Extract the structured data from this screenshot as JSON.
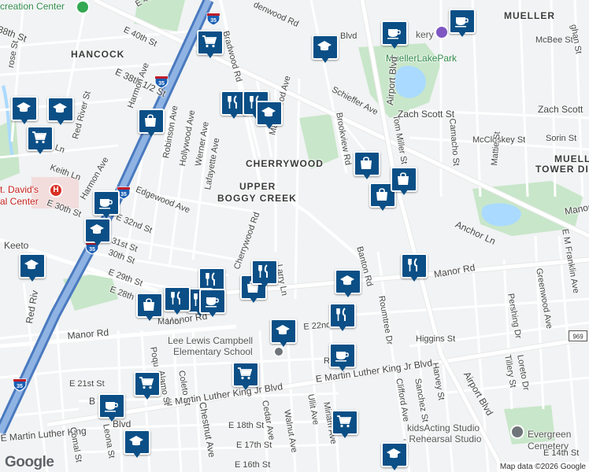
{
  "map": {
    "attribution": "Map data ©2026 Google",
    "logo": "Google",
    "colors": {
      "water": "#aadaff",
      "park": "#c5e8c5",
      "highway": "#5b8cc9",
      "road": "#ffffff",
      "marker": "#0b4f86",
      "hospital": "#d93025"
    },
    "areas": [
      {
        "id": "hancock",
        "text": "HANCOCK"
      },
      {
        "id": "cherrywood",
        "text": "CHERRYWOOD"
      },
      {
        "id": "upper1",
        "text": "UPPER"
      },
      {
        "id": "upper2",
        "text": "BOGGY CREEK"
      },
      {
        "id": "mueller",
        "text": "MUELLER"
      },
      {
        "id": "mtd1",
        "text": "MUELLER"
      },
      {
        "id": "mtd2",
        "text": "TOWER DISTR"
      }
    ],
    "places": [
      {
        "id": "creation",
        "text": "creation Center"
      },
      {
        "id": "stdavid1",
        "text": "t. David's"
      },
      {
        "id": "stdavid2",
        "text": "al Center"
      },
      {
        "id": "school1",
        "text": "Lee Lewis Campbell"
      },
      {
        "id": "school2",
        "text": "Elementary School"
      },
      {
        "id": "muellerpark",
        "text": "MuellerLakePark"
      },
      {
        "id": "kids1",
        "text": "kidsActing Studio"
      },
      {
        "id": "kids2",
        "text": "- Rehearsal Studio"
      },
      {
        "id": "evergreen1",
        "text": "Evergreen"
      },
      {
        "id": "evergreen2",
        "text": "Cemetery"
      },
      {
        "id": "ery",
        "text": "kery"
      }
    ],
    "streets": [
      {
        "id": "s1",
        "text": "E 41st St"
      },
      {
        "id": "s2",
        "text": "E 40th St"
      },
      {
        "id": "s3",
        "text": "E 38th 1/2 St"
      },
      {
        "id": "s4",
        "text": "38th St"
      },
      {
        "id": "s5",
        "text": "rose St"
      },
      {
        "id": "s6",
        "text": "Red River St"
      },
      {
        "id": "s7",
        "text": "Luther Ln"
      },
      {
        "id": "s8",
        "text": "Keith Ln"
      },
      {
        "id": "s9",
        "text": "Harmon Ave"
      },
      {
        "id": "s10",
        "text": "Harmon Ave"
      },
      {
        "id": "s11",
        "text": "Robinson Ave"
      },
      {
        "id": "s12",
        "text": "Hollywood Ave"
      },
      {
        "id": "s13",
        "text": "Werner Ave"
      },
      {
        "id": "s14",
        "text": "Lafayette Ave"
      },
      {
        "id": "s15",
        "text": "Edgewood Ave"
      },
      {
        "id": "s16",
        "text": "E 32nd St"
      },
      {
        "id": "s17",
        "text": "E 30th St"
      },
      {
        "id": "s18",
        "text": "31st St"
      },
      {
        "id": "s19",
        "text": "30th St"
      },
      {
        "id": "s20",
        "text": "E 29th St"
      },
      {
        "id": "s21",
        "text": "E 28th St"
      },
      {
        "id": "s22",
        "text": "Keeto"
      },
      {
        "id": "s23",
        "text": "Red Riv"
      },
      {
        "id": "s24",
        "text": "Bradwood Rd"
      },
      {
        "id": "s25",
        "text": "denwood Rd"
      },
      {
        "id": "s26",
        "text": "Maplewood Ave"
      },
      {
        "id": "s27",
        "text": "Cherrywood Rd"
      },
      {
        "id": "s28",
        "text": "Larry Ln"
      },
      {
        "id": "s29",
        "text": "Schieffer Ave"
      },
      {
        "id": "s30",
        "text": "Brookview Rd"
      },
      {
        "id": "s31",
        "text": "Airport Blvd"
      },
      {
        "id": "s32",
        "text": "Tom Miller St"
      },
      {
        "id": "s33",
        "text": "Zach Scott St"
      },
      {
        "id": "s34",
        "text": "Zach Scott"
      },
      {
        "id": "s35",
        "text": "McBee St"
      },
      {
        "id": "s36",
        "text": "McCloskey St"
      },
      {
        "id": "s37",
        "text": "Sorin St"
      },
      {
        "id": "s38",
        "text": "Camacho St"
      },
      {
        "id": "s39",
        "text": "Mattie St"
      },
      {
        "id": "s40",
        "text": "Anchor Ln"
      },
      {
        "id": "s41",
        "text": "Manor Rd"
      },
      {
        "id": "s42",
        "text": "Banton Rd"
      },
      {
        "id": "s43",
        "text": "Manor Rd"
      },
      {
        "id": "s44",
        "text": "Manor Rd"
      },
      {
        "id": "s45",
        "text": "Manor"
      },
      {
        "id": "s46",
        "text": "Roumtree Dr"
      },
      {
        "id": "s47",
        "text": "Higgins St"
      },
      {
        "id": "s48",
        "text": "E M Franklin Ave"
      },
      {
        "id": "s49",
        "text": "Greenwood Ave"
      },
      {
        "id": "s50",
        "text": "Pershing Dr"
      },
      {
        "id": "s51",
        "text": "Loreto Dr"
      },
      {
        "id": "s52",
        "text": "Tillery St"
      },
      {
        "id": "s53",
        "text": "Airport Blvd"
      },
      {
        "id": "s54",
        "text": "Harvey St"
      },
      {
        "id": "s55",
        "text": "Sanchez St"
      },
      {
        "id": "s56",
        "text": "Clifford Ave"
      },
      {
        "id": "s57",
        "text": "E Martin Luther King Jr Blvd"
      },
      {
        "id": "s58",
        "text": "E Martin Luther King Jr Blvd"
      },
      {
        "id": "s59",
        "text": "E Martin Luther King"
      },
      {
        "id": "s60",
        "text": "E 22nd St"
      },
      {
        "id": "s61",
        "text": "E 21st St"
      },
      {
        "id": "s62",
        "text": "E 18th St"
      },
      {
        "id": "s63",
        "text": "E 17th St"
      },
      {
        "id": "s64",
        "text": "E 16th St"
      },
      {
        "id": "s65",
        "text": "E 14th St"
      },
      {
        "id": "s66",
        "text": "Alamo St"
      },
      {
        "id": "s67",
        "text": "Coleto St"
      },
      {
        "id": "s68",
        "text": "Chestnut Ave"
      },
      {
        "id": "s69",
        "text": "Cedar Ave"
      },
      {
        "id": "s70",
        "text": "Walnut Ave"
      },
      {
        "id": "s71",
        "text": "Ullit Ave"
      },
      {
        "id": "s72",
        "text": "Miriam Ave"
      },
      {
        "id": "s73",
        "text": "Leona St"
      },
      {
        "id": "s74",
        "text": "Comal St"
      },
      {
        "id": "s75",
        "text": "Poqu"
      },
      {
        "id": "s76",
        "text": "Ro"
      },
      {
        "id": "s77",
        "text": "B"
      },
      {
        "id": "s78",
        "text": "Blvd"
      },
      {
        "id": "s79",
        "text": "Manor"
      },
      {
        "id": "s80",
        "text": "ghan St"
      },
      {
        "id": "s81",
        "text": "Blvd"
      }
    ],
    "shields": [
      {
        "id": "i35a",
        "text": "35"
      },
      {
        "id": "i35b",
        "text": "35"
      },
      {
        "id": "i35c",
        "text": "35"
      },
      {
        "id": "i35d",
        "text": "35"
      },
      {
        "id": "i35e",
        "text": "35"
      },
      {
        "id": "r969",
        "text": "969"
      }
    ],
    "markers": [
      {
        "id": "m1",
        "icon": "school-icon"
      },
      {
        "id": "m2",
        "icon": "school-icon"
      },
      {
        "id": "m3",
        "icon": "grocery-cart-icon"
      },
      {
        "id": "m4",
        "icon": "shopping-bag-icon"
      },
      {
        "id": "m5",
        "icon": "grocery-cart-icon"
      },
      {
        "id": "m6",
        "icon": "restaurant-icon"
      },
      {
        "id": "m7",
        "icon": "restaurant-icon"
      },
      {
        "id": "m8",
        "icon": "school-icon"
      },
      {
        "id": "m9",
        "icon": "school-icon"
      },
      {
        "id": "m10",
        "icon": "coffee-icon"
      },
      {
        "id": "m11",
        "icon": "coffee-icon"
      },
      {
        "id": "m12",
        "icon": "shopping-bag-icon"
      },
      {
        "id": "m13",
        "icon": "shopping-bag-icon"
      },
      {
        "id": "m14",
        "icon": "shopping-bag-icon"
      },
      {
        "id": "m15",
        "icon": "coffee-icon"
      },
      {
        "id": "m16",
        "icon": "school-icon"
      },
      {
        "id": "m17",
        "icon": "school-icon"
      },
      {
        "id": "m18",
        "icon": "restaurant-icon"
      },
      {
        "id": "m19",
        "icon": "shopping-bag-icon"
      },
      {
        "id": "m20",
        "icon": "restaurant-icon"
      },
      {
        "id": "m21",
        "icon": "restaurant-icon"
      },
      {
        "id": "m22",
        "icon": "restaurant-icon"
      },
      {
        "id": "m23",
        "icon": "shopping-bag-icon"
      },
      {
        "id": "m24",
        "icon": "coffee-icon"
      },
      {
        "id": "m25",
        "icon": "school-icon"
      },
      {
        "id": "m26",
        "icon": "restaurant-icon"
      },
      {
        "id": "m27",
        "icon": "school-icon"
      },
      {
        "id": "m28",
        "icon": "restaurant-icon"
      },
      {
        "id": "m29",
        "icon": "coffee-icon"
      },
      {
        "id": "m30",
        "icon": "grocery-cart-icon"
      },
      {
        "id": "m31",
        "icon": "grocery-cart-icon"
      },
      {
        "id": "m32",
        "icon": "coffee-icon"
      },
      {
        "id": "m33",
        "icon": "school-icon"
      },
      {
        "id": "m34",
        "icon": "grocery-cart-icon"
      },
      {
        "id": "m35",
        "icon": "school-icon"
      }
    ]
  }
}
